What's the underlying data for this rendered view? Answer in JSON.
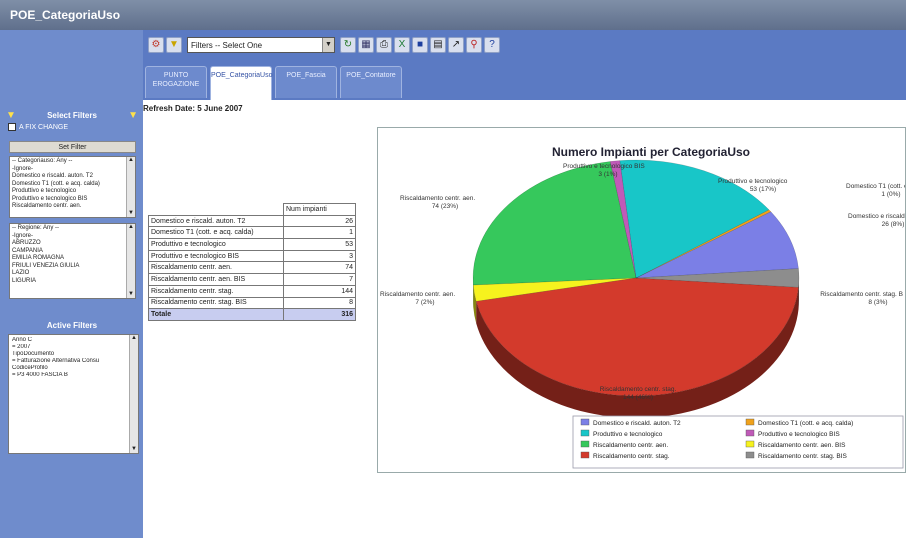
{
  "app": {
    "title": "POE_CategoriaUso"
  },
  "toolbar": {
    "filter_select": "Filters -- Select One",
    "icons": [
      "gear-icon",
      "funnel-icon",
      "refresh-icon",
      "chart-icon",
      "print-icon",
      "excel-icon",
      "save-icon",
      "grid-icon",
      "arrow-icon",
      "zoom-icon",
      "help-icon"
    ]
  },
  "tabs": [
    {
      "label": "PUNTO EROGAZIONE"
    },
    {
      "label": "POE_CategoriaUso"
    },
    {
      "label": "POE_Fascia"
    },
    {
      "label": "POE_Contatore"
    }
  ],
  "refresh": "Refresh Date: 5 June 2007",
  "sidebar": {
    "select_filters": "Select Filters",
    "checkbox_label": "A FIX CHANGE",
    "set_filter": "Set Filter",
    "list1": [
      "-- Categoriauso: Any --",
      "-Ignore-",
      "Domestico e riscald. auton. T2",
      "Domestico T1 (cott. e acq. calda)",
      "Produttivo e tecnologico",
      "Produttivo e tecnologico BIS",
      "Riscaldamento centr. aen."
    ],
    "list2": [
      "-- Regione: Any --",
      "-Ignore-",
      "ABRUZZO",
      "CAMPANIA",
      "EMILIA ROMAGNA",
      "FRIULI VENEZIA GIULIA",
      "LAZIO",
      "LIGURIA"
    ],
    "active_filters": "Active Filters",
    "active_lines": [
      "Anno C",
      "  = 2007",
      "TipoDocumento",
      "  = Fatturazione Alternativa Consu",
      "CodiceProfilo",
      "  = P3 4000 FASCIA B"
    ]
  },
  "table": {
    "header": "Num impianti",
    "rows": [
      {
        "label": "Domestico e riscald. auton. T2",
        "value": "26"
      },
      {
        "label": "Domestico T1 (cott. e acq. calda)",
        "value": "1"
      },
      {
        "label": "Produttivo e tecnologico",
        "value": "53"
      },
      {
        "label": "Produttivo e tecnologico BIS",
        "value": "3"
      },
      {
        "label": "Riscaldamento centr. aen.",
        "value": "74"
      },
      {
        "label": "Riscaldamento centr. aen. BIS",
        "value": "7"
      },
      {
        "label": "Riscaldamento centr. stag.",
        "value": "144"
      },
      {
        "label": "Riscaldamento centr. stag. BIS",
        "value": "8"
      }
    ],
    "total_label": "Totale",
    "total_value": "316"
  },
  "chart_data": {
    "type": "pie",
    "title": "Numero Impianti per CategoriaUso",
    "categories": [
      "Domestico e riscald. auton. T2",
      "Domestico T1 (cott. e acq. calda)",
      "Produttivo e tecnologico",
      "Produttivo e tecnologico BIS",
      "Riscaldamento centr. aen.",
      "Riscaldamento centr. aen. BIS",
      "Riscaldamento centr. stag.",
      "Riscaldamento centr. stag. BIS"
    ],
    "values": [
      26,
      1,
      53,
      3,
      74,
      7,
      144,
      8
    ],
    "labels": [
      [
        "Domestico e riscald. auton. T2",
        "26 (8%)"
      ],
      [
        "Domestico T1 (cott. e acq. calda)",
        "1 (0%)"
      ],
      [
        "Produttivo e tecnologico",
        "53 (17%)"
      ],
      [
        "Produttivo e tecnologico BIS",
        "3 (1%)"
      ],
      [
        "Riscaldamento centr. aen.",
        "74 (23%)"
      ],
      [
        "Riscaldamento centr. aen.",
        "7 (2%)"
      ],
      [
        "Riscaldamento centr. stag.",
        "144 (46%)"
      ],
      [
        "Riscaldamento centr. stag. B",
        "8 (3%)"
      ]
    ],
    "legend": [
      "Domestico e riscald. auton. T2",
      "Domestico T1 (cott. e acq. calda)",
      "Produttivo e tecnologico",
      "Produttivo e tecnologico BIS",
      "Riscaldamento centr. aen.",
      "Riscaldamento centr. aen. BIS",
      "Riscaldamento centr. stag.",
      "Riscaldamento centr. stag. BIS"
    ],
    "legend_position": "bottom-right",
    "colors": [
      "#7b7fe6",
      "#f0a21c",
      "#18c6c8",
      "#c05ab8",
      "#36c85c",
      "#f6f21e",
      "#d33a2c",
      "#8d8d8d"
    ]
  }
}
